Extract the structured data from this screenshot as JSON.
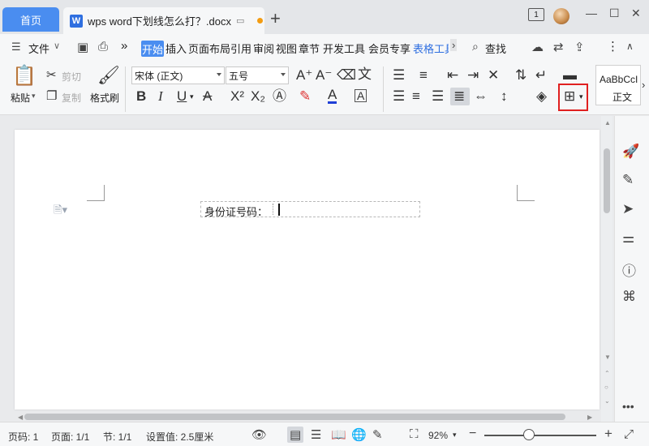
{
  "titlebar": {
    "home_tab": "首页",
    "doc_icon": "W",
    "doc_tab": "wps word下划线怎么打？.docx",
    "new_tab": "+",
    "badge": "1",
    "minimize": "—",
    "maximize": "☐",
    "close": "✕"
  },
  "menubar": {
    "file": "文件",
    "more": "»",
    "tabs": [
      "开始",
      "插入",
      "页面布局",
      "引用",
      "审阅",
      "视图",
      "章节",
      "开发工具",
      "会员专享",
      "表格工具"
    ],
    "search": "查找",
    "more_dots": "⋮"
  },
  "ribbon": {
    "paste": "粘贴",
    "cut": "剪切",
    "copy": "复制",
    "format_painter": "格式刷",
    "font_name": "宋体 (正文)",
    "font_size": "五号",
    "style_preview": "AaBbCcI",
    "style_name": "正文"
  },
  "document": {
    "field_label": "身份证号码："
  },
  "statusbar": {
    "page_num": "页码: 1",
    "pages": "页面: 1/1",
    "section": "节: 1/1",
    "setting": "设置值: 2.5厘米",
    "zoom": "92%",
    "zoom_level": 0.4
  },
  "colors": {
    "accent": "#4a8df0",
    "highlight_border": "#e02020",
    "font_color_underline": "#1f3fd6"
  },
  "icons": [
    "doc-icon",
    "monitor-icon",
    "cloud-icon",
    "share-icon",
    "export-icon",
    "rocket-icon",
    "pen-icon",
    "cursor-icon",
    "settings-slider-icon",
    "help-icon",
    "feedback-icon",
    "eye-icon",
    "zoom-fit-icon",
    "fullscreen-icon"
  ]
}
